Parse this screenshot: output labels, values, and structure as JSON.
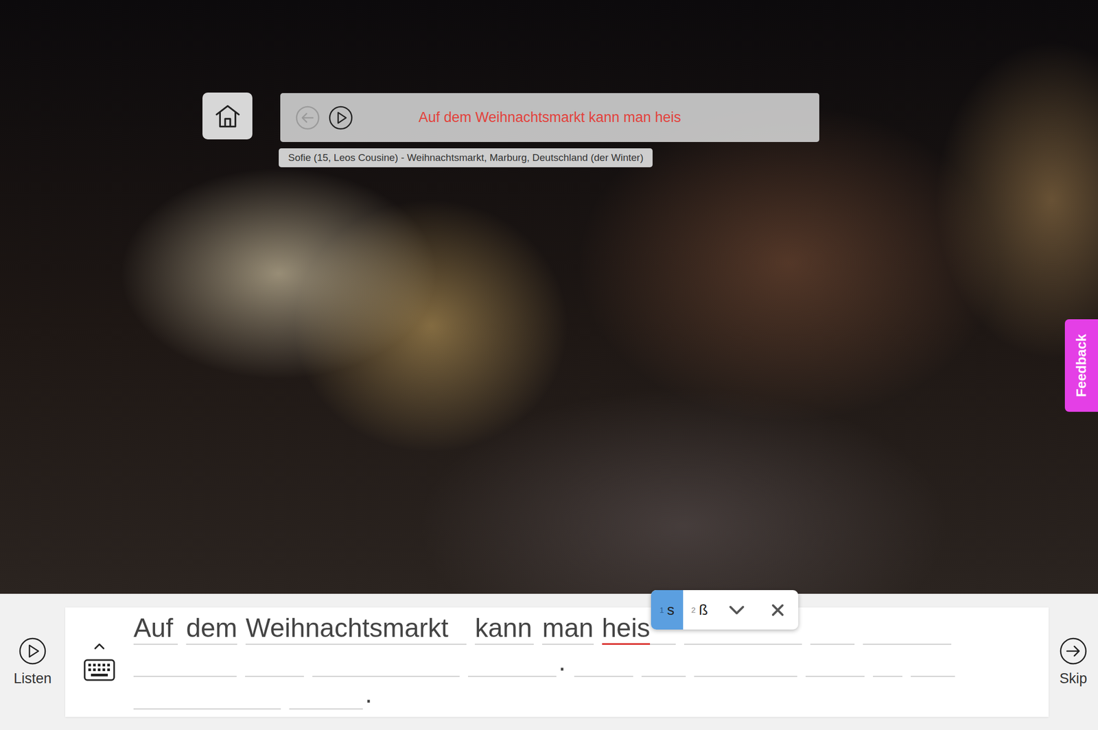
{
  "caption": {
    "text": "Auf dem Weihnachtsmarkt kann man heis",
    "back_enabled": false
  },
  "scene": {
    "label": "Sofie (15, Leos Cousine) - Weihnachtsmarkt, Marburg, Deutschland (der Winter)"
  },
  "feedback": {
    "label": "Feedback"
  },
  "listen": {
    "label": "Listen"
  },
  "skip": {
    "label": "Skip"
  },
  "answer": {
    "rows": [
      [
        {
          "kind": "word",
          "text": "Auf",
          "length": 3,
          "active": false
        },
        {
          "kind": "word",
          "text": "dem",
          "length": 3,
          "active": false
        },
        {
          "kind": "word",
          "text": "Weihnachtsmarkt",
          "length": 15,
          "active": false
        },
        {
          "kind": "word",
          "text": "kann",
          "length": 4,
          "active": false
        },
        {
          "kind": "word",
          "text": "man",
          "length": 3,
          "active": false
        },
        {
          "kind": "word",
          "text": "heis",
          "length": 5,
          "active": true
        },
        {
          "kind": "word",
          "text": "",
          "length": 8,
          "active": false
        },
        {
          "kind": "word",
          "text": "",
          "length": 3,
          "active": false
        },
        {
          "kind": "word",
          "text": "",
          "length": 6,
          "active": false
        }
      ],
      [
        {
          "kind": "word",
          "text": "",
          "length": 7,
          "active": false
        },
        {
          "kind": "word",
          "text": "",
          "length": 4,
          "active": false
        },
        {
          "kind": "word",
          "text": "",
          "length": 10,
          "active": false
        },
        {
          "kind": "word",
          "text": "",
          "length": 6,
          "active": false
        },
        {
          "kind": "punct",
          "text": "."
        },
        {
          "kind": "word",
          "text": "",
          "length": 4,
          "active": false
        },
        {
          "kind": "word",
          "text": "",
          "length": 3,
          "active": false
        },
        {
          "kind": "word",
          "text": "",
          "length": 7,
          "active": false
        },
        {
          "kind": "word",
          "text": "",
          "length": 4,
          "active": false
        },
        {
          "kind": "word",
          "text": "",
          "length": 2,
          "active": false
        },
        {
          "kind": "word",
          "text": "",
          "length": 3,
          "active": false
        }
      ],
      [
        {
          "kind": "word",
          "text": "",
          "length": 10,
          "active": false
        },
        {
          "kind": "word",
          "text": "",
          "length": 5,
          "active": false
        },
        {
          "kind": "punct",
          "text": "."
        }
      ]
    ]
  },
  "suggestions": {
    "options": [
      {
        "key": "1",
        "char": "s",
        "selected": true
      },
      {
        "key": "2",
        "char": "ß",
        "selected": false
      }
    ]
  }
}
